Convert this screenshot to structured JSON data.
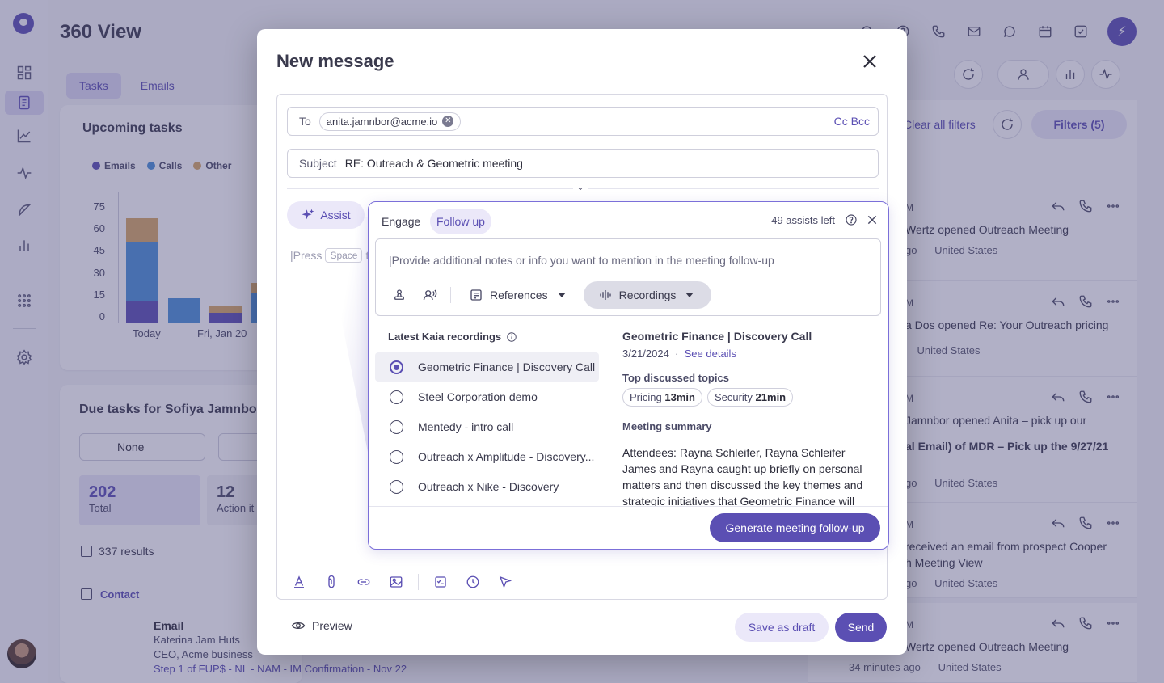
{
  "app": {
    "title": "360 View"
  },
  "colors": {
    "accent": "#5b4fb3",
    "emails": "#5b4fb3",
    "calls": "#4a8fd8",
    "other": "#d7a764"
  },
  "background": {
    "tabs": [
      {
        "label": "Tasks"
      },
      {
        "label": "Emails"
      }
    ],
    "upcoming": {
      "title": "Upcoming tasks",
      "legend": [
        "Emails",
        "Calls",
        "Other"
      ],
      "yticks": [
        "75",
        "60",
        "45",
        "30",
        "15",
        "0"
      ],
      "xticks": [
        "Today",
        "Fri, Jan 20"
      ]
    },
    "due": {
      "title": "Due tasks for Sofiya Jamnbo",
      "filter_none": "None",
      "total_value": "202",
      "total_label": "Total",
      "action_value": "12",
      "action_label": "Action it",
      "results": "337 results",
      "contact_header": "Contact"
    },
    "email_row": {
      "type": "Email",
      "name": "Katerina Jam Huts",
      "role": "CEO, Acme business",
      "step": "Step 1 of FUP$ - NL - NAM - IM Confirmation - Nov 22"
    },
    "filters": {
      "clear": "Clear all filters",
      "filters": "Filters (5)"
    },
    "activity": [
      {
        "time": "M",
        "line1": "Wertz opened Outreach Meeting",
        "line2": "",
        "meta_ago": "go",
        "meta_country": "United States"
      },
      {
        "time": "M",
        "line1": "a Dos opened Re: Your Outreach pricing",
        "line2": "",
        "meta_ago": "",
        "meta_country": "United States"
      },
      {
        "time": "M",
        "line1": "Jamnbor opened Anita – pick up our",
        "line2": "al Email) of MDR – Pick up the 9/27/21",
        "meta_ago": "go",
        "meta_country": "United States"
      },
      {
        "time": "M",
        "line1": "received an email from prospect Cooper",
        "line2": "h Meeting View",
        "meta_ago": "go",
        "meta_country": "United States"
      },
      {
        "time": "M",
        "line1": "Wertz opened Outreach Meeting",
        "line2": "",
        "meta_ago": "34 minutes ago",
        "meta_country": "United States"
      }
    ]
  },
  "modal": {
    "title": "New message",
    "to_label": "To",
    "to_chip": "anita.jamnbor@acme.io",
    "cc_bcc": "Cc Bcc",
    "subject_label": "Subject",
    "subject_value": "RE: Outreach & Geometric meeting",
    "assist_label": "Assist",
    "body_placeholder_prefix": "|Press",
    "body_placeholder_key": "Space",
    "body_placeholder_suffix": "t",
    "preview_label": "Preview",
    "save_draft_label": "Save as draft",
    "send_label": "Send"
  },
  "assist": {
    "tabs": [
      {
        "label": "Engage"
      },
      {
        "label": "Follow up"
      }
    ],
    "assists_left": "49 assists left",
    "notes_placeholder": "|Provide additional notes or info you want to mention in the meeting follow-up",
    "references_label": "References",
    "recordings_label": "Recordings",
    "list_title": "Latest Kaia recordings",
    "recordings": [
      {
        "title": "Geometric Finance | Discovery Call",
        "selected": true
      },
      {
        "title": "Steel Corporation demo",
        "selected": false
      },
      {
        "title": "Mentedy - intro call",
        "selected": false
      },
      {
        "title": "Outreach x Amplitude - Discovery...",
        "selected": false
      },
      {
        "title": "Outreach x Nike - Discovery",
        "selected": false
      }
    ],
    "detail": {
      "title": "Geometric Finance | Discovery Call",
      "date": "3/21/2024",
      "see_details": "See details",
      "topics_title": "Top discussed topics",
      "topics": [
        {
          "name": "Pricing",
          "duration": "13min"
        },
        {
          "name": "Security",
          "duration": "21min"
        }
      ],
      "summary_title": "Meeting summary",
      "summary": "Attendees: Rayna Schleifer, Rayna Schleifer James and Rayna caught up briefly on personal matters and then discussed the key themes and strategic initiatives that Geometric Finance will"
    },
    "generate_label": "Generate meeting follow-up"
  }
}
